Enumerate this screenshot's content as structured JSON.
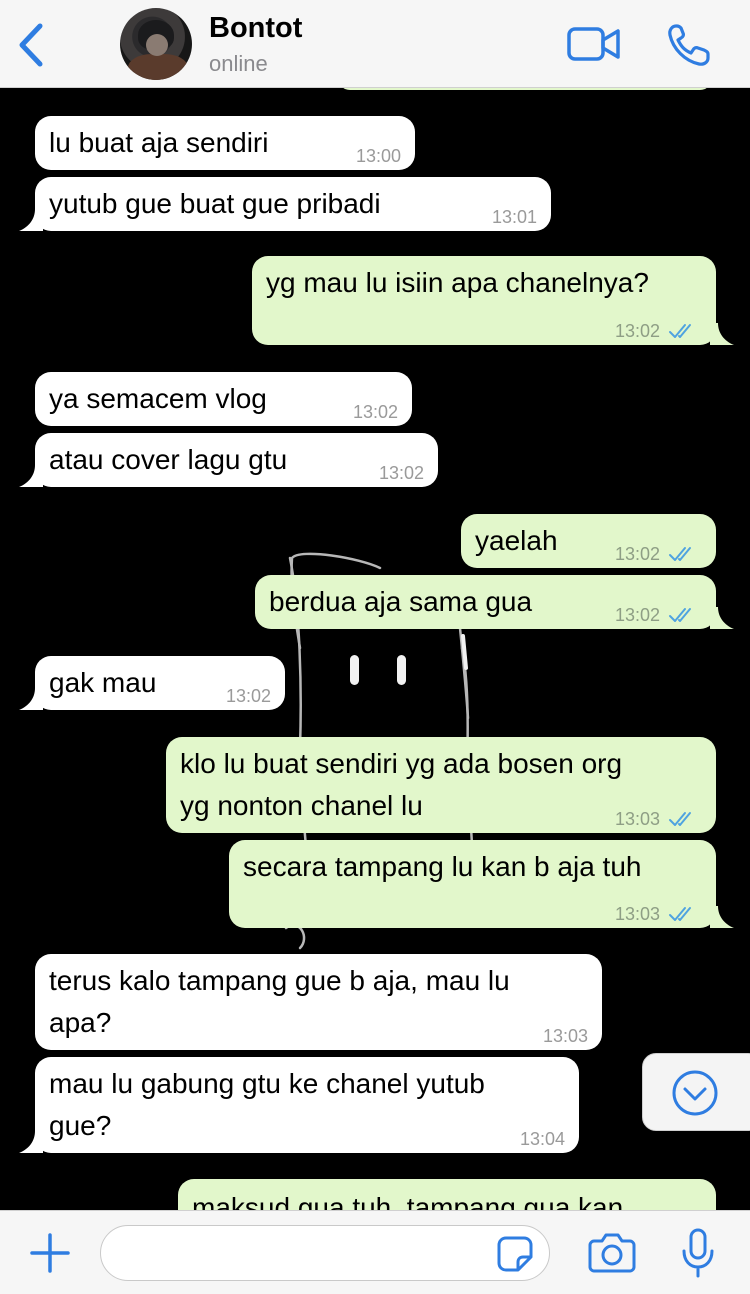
{
  "header": {
    "contact_name": "Bontot",
    "status": "online",
    "back_icon": "chevron-left-icon",
    "video_icon": "video-camera-icon",
    "call_icon": "phone-icon",
    "accent_color": "#2f7de1"
  },
  "messages": [
    {
      "dir": "in",
      "text": "lu buat aja sendiri",
      "time": "13:00"
    },
    {
      "dir": "in",
      "text": "yutub gue buat gue pribadi",
      "time": "13:01"
    },
    {
      "dir": "out",
      "text": "yg mau lu isiin apa chanelnya?",
      "time": "13:02",
      "read": true
    },
    {
      "dir": "in",
      "text": "ya semacem vlog",
      "time": "13:02"
    },
    {
      "dir": "in",
      "text": "atau cover lagu gtu",
      "time": "13:02"
    },
    {
      "dir": "out",
      "text": "yaelah",
      "time": "13:02",
      "read": true
    },
    {
      "dir": "out",
      "text": "berdua aja sama gua",
      "time": "13:02",
      "read": true
    },
    {
      "dir": "in",
      "text": "gak mau",
      "time": "13:02"
    },
    {
      "dir": "out",
      "line1": "klo lu buat sendiri yg ada bosen org",
      "line2": "yg nonton chanel lu",
      "time": "13:03",
      "read": true
    },
    {
      "dir": "out",
      "text": "secara tampang lu kan b aja tuh",
      "time": "13:03",
      "read": true
    },
    {
      "dir": "in",
      "line1": "terus kalo tampang gue b aja, mau lu",
      "line2": "apa?",
      "time": "13:03"
    },
    {
      "dir": "in",
      "line1": "mau lu gabung gtu ke chanel yutub",
      "line2": "gue?",
      "time": "13:04"
    },
    {
      "dir": "out",
      "text": "maksud gua tuh, tampang gua kan"
    }
  ],
  "colors": {
    "incoming": "#ffffff",
    "outgoing": "#e2f7cb",
    "read_ticks": "#4fa3e0",
    "background": "#000000"
  },
  "input": {
    "placeholder": "",
    "plus_icon": "plus-icon",
    "sticker_icon": "sticker-icon",
    "camera_icon": "camera-icon",
    "mic_icon": "microphone-icon"
  },
  "scroll_button_icon": "chevron-down-circle-icon"
}
